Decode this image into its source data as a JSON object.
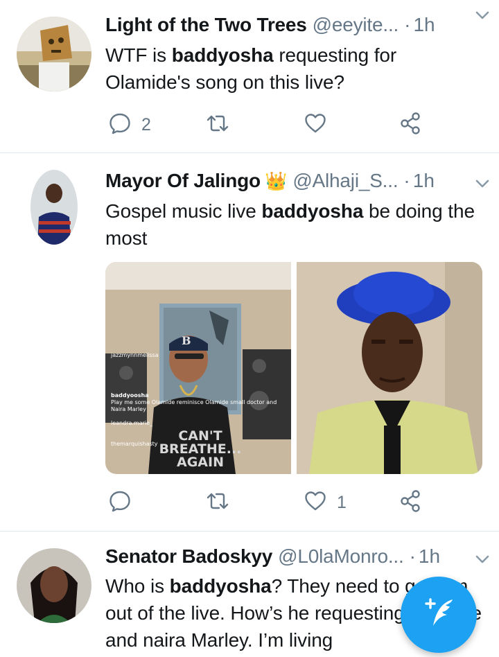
{
  "tweets": [
    {
      "name": "Light of the Two Trees",
      "handle": "@eeyite...",
      "dot": "·",
      "time": "1h",
      "body": {
        "p1": "WTF is ",
        "bold": "baddyosha",
        "p2": " requesting for Olamide's song on this live?"
      },
      "actions": {
        "reply_count": "2",
        "retweet_count": "",
        "like_count": ""
      }
    },
    {
      "name": "Mayor Of Jalingo",
      "crown": "👑",
      "handle": "@Alhaji_S...",
      "dot": "·",
      "time": "1h",
      "body": {
        "p1": "Gospel music live ",
        "bold": "baddyosha",
        "p2": " be doing the most"
      },
      "media": {
        "left": {
          "comment1_user": "jazzmynnmelissa",
          "comment2_user": "baddyoosha",
          "comment2_text": "Play me some Olamide reminisce Olamide small doctor and Naira Marley",
          "comment3_user": "leandra.marie_",
          "comment4_user": "themarquishasty",
          "cap_text": "B",
          "shirt_line1": "CAN'T",
          "shirt_line2": "BREATHE...",
          "shirt_line3": "AGAIN"
        }
      },
      "actions": {
        "reply_count": "",
        "retweet_count": "",
        "like_count": "1"
      }
    },
    {
      "name": "Senator Badoskyy",
      "handle": "@L0laMonro...",
      "dot": "·",
      "time": "1h",
      "body": {
        "p1": "Who is ",
        "bold": "baddyosha",
        "p2": "? They need to get him out of the live. How’s he requesting Olamide and naira Marley. I’m living"
      }
    }
  ],
  "colors": {
    "accent": "#1da1f2",
    "secondary_text": "#657786",
    "divider": "#e1e8ed"
  },
  "icons": {
    "reply": "reply-icon",
    "retweet": "retweet-icon",
    "like": "heart-icon",
    "share": "share-icon",
    "menu": "chevron-down-icon",
    "compose": "compose-tweet-icon"
  }
}
